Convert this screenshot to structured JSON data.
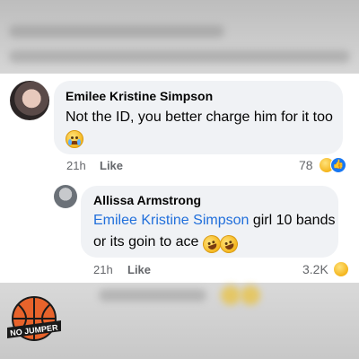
{
  "comments": [
    {
      "author": "Emilee Kristine Simpson",
      "text": "Not the ID, you better charge him for it too",
      "emoji": "loudly-crying-face",
      "time": "21h",
      "like_label": "Like",
      "reaction_count": "78",
      "reactions": [
        "haha",
        "like"
      ]
    },
    {
      "author": "Allissa Armstrong",
      "mention": "Emilee Kristine Simpson",
      "text_after_mention": " girl 10 bands",
      "text_line2": "or its goin to ace",
      "emoji": [
        "rolling-on-floor-laughing",
        "rolling-on-floor-laughing"
      ],
      "time": "21h",
      "like_label": "Like",
      "reaction_count": "3.2K",
      "reactions": [
        "haha"
      ]
    }
  ],
  "logo": {
    "text": "NO JUMPER",
    "colors": {
      "ball": "#e8632b",
      "banner": "#1a1a1a"
    }
  },
  "colors": {
    "mention": "#216fdb",
    "bubble": "#f0f2f5",
    "meta": "#65676b",
    "like_reaction": "#1877f2"
  }
}
